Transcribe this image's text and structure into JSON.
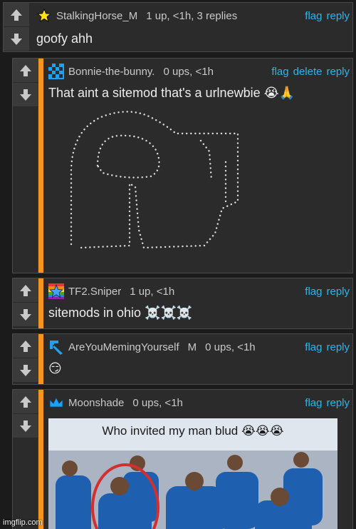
{
  "vote": {
    "up_icon": "arrow-up-icon",
    "down_icon": "arrow-down-icon"
  },
  "colors": {
    "accent_bar": "#f7941d",
    "link": "#2fb4ea",
    "panel": "#2b2b2b"
  },
  "comments": [
    {
      "avatar_icon": "star-icon",
      "username": "StalkingHorse_M",
      "votes": "1 up, <1h, 3 replies",
      "actions": [
        "flag",
        "reply"
      ],
      "body": "goofy ahh"
    },
    {
      "avatar_icon": "checkered-avatar-icon",
      "username": "Bonnie-the-bunny.",
      "votes": "0 ups, <1h",
      "actions": [
        "flag",
        "delete",
        "reply"
      ],
      "body": "That aint a sitemod that's a urlnewbie 😭🙏",
      "ascii_art_icon": "dotted-letter-r-art"
    },
    {
      "avatar_icon": "rainbow-star-icon",
      "username": "TF2.Sniper",
      "votes": "1 up, <1h",
      "actions": [
        "flag",
        "reply"
      ],
      "body": "sitemods in ohio ☠️☠️☠️"
    },
    {
      "avatar_icon": "blue-arrow-avatar-icon",
      "username": "AreYouMemingYourself",
      "mod_badge": "M",
      "votes": "0 ups, <1h",
      "actions": [
        "flag",
        "reply"
      ],
      "body": "😏"
    },
    {
      "avatar_icon": "crown-icon",
      "username": "Moonshade",
      "votes": "0 ups, <1h",
      "actions": [
        "flag",
        "reply"
      ],
      "meme_caption": "Who invited my man blud 😭😭😭"
    }
  ],
  "watermark": "imgflip.com"
}
